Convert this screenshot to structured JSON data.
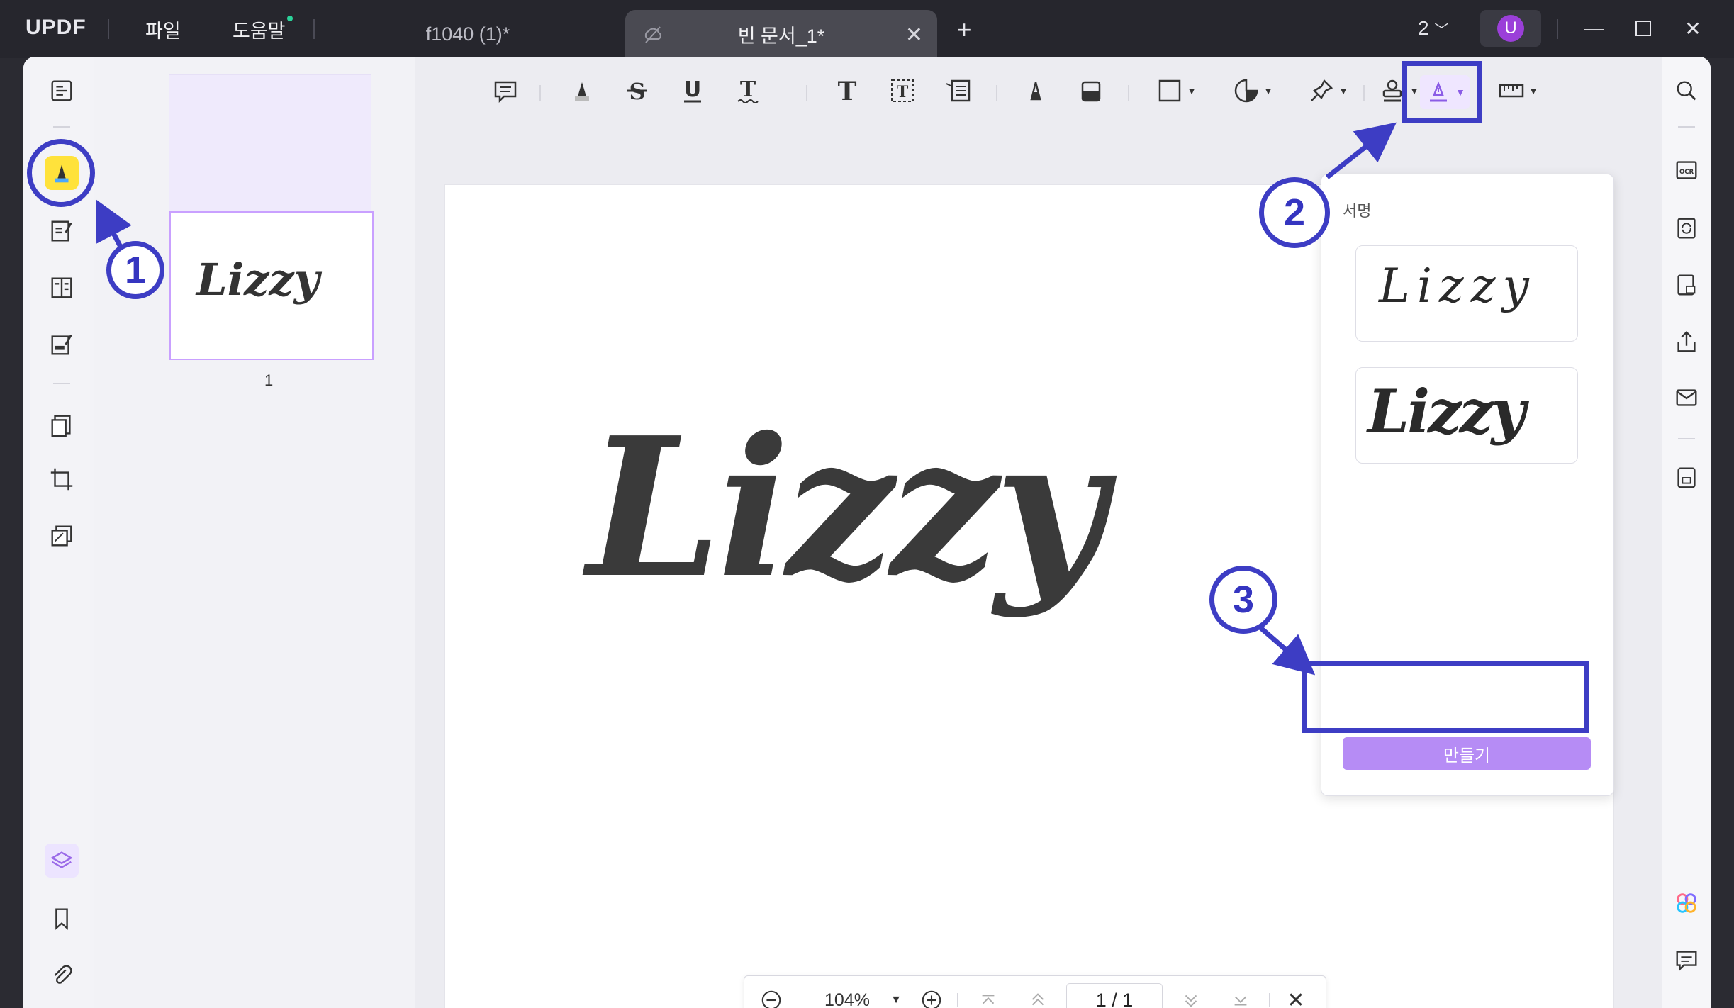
{
  "app": {
    "logo": "UPDF"
  },
  "menu": {
    "file": "파일",
    "help": "도움말"
  },
  "tabs": [
    {
      "label": "f1040 (1)*"
    },
    {
      "label": "빈 문서_1*"
    }
  ],
  "window": {
    "count": "2",
    "user_initial": "U"
  },
  "thumbnail": {
    "page_number": "1",
    "signature_text": "Lizzy"
  },
  "document": {
    "signature_text": "Lizzy"
  },
  "signature_panel": {
    "title": "서명",
    "signatures": [
      {
        "text": "Lizzy",
        "style": "handwritten"
      },
      {
        "text": "Lizzy",
        "style": "script"
      }
    ],
    "create_label": "만들기"
  },
  "zoom": {
    "level": "104%",
    "page_current": "1",
    "page_separator": "/",
    "page_total": "1"
  },
  "annotations": [
    {
      "number": "1"
    },
    {
      "number": "2"
    },
    {
      "number": "3"
    }
  ],
  "colors": {
    "accent": "#b68cf5",
    "annotation": "#3d3dc4",
    "highlight": "#ffe23b",
    "titlebar": "#26262d"
  }
}
